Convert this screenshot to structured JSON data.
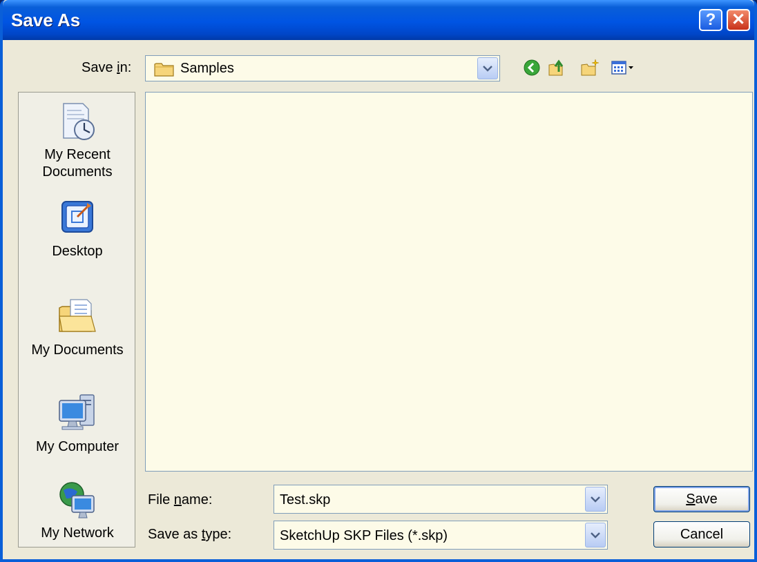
{
  "window": {
    "title": "Save As"
  },
  "titlebar": {
    "help_glyph": "?",
    "close_glyph": "✕"
  },
  "save_in": {
    "label_pre": "Save ",
    "label_u": "i",
    "label_post": "n:",
    "value": "Samples"
  },
  "toolbar": {
    "icons": [
      "back-icon",
      "up-folder-icon",
      "new-folder-icon",
      "views-menu-icon"
    ]
  },
  "places": [
    {
      "label": "My Recent\nDocuments",
      "icon": "recent-documents-icon"
    },
    {
      "label": "Desktop",
      "icon": "desktop-icon"
    },
    {
      "label": "My Documents",
      "icon": "my-documents-icon"
    },
    {
      "label": "My Computer",
      "icon": "my-computer-icon"
    },
    {
      "label": "My Network",
      "icon": "my-network-icon"
    }
  ],
  "file_name": {
    "label_pre": "File ",
    "label_u": "n",
    "label_post": "ame:",
    "value": "Test.skp"
  },
  "save_type": {
    "label_pre": "Save as ",
    "label_u": "t",
    "label_post": "ype:",
    "value": "SketchUp SKP Files (*.skp)"
  },
  "buttons": {
    "save_u": "S",
    "save_rest": "ave",
    "cancel": "Cancel"
  },
  "colors": {
    "title_bar": "#0054e3",
    "dialog_bg": "#ece9d8",
    "field_bg": "#fdfbe8"
  }
}
